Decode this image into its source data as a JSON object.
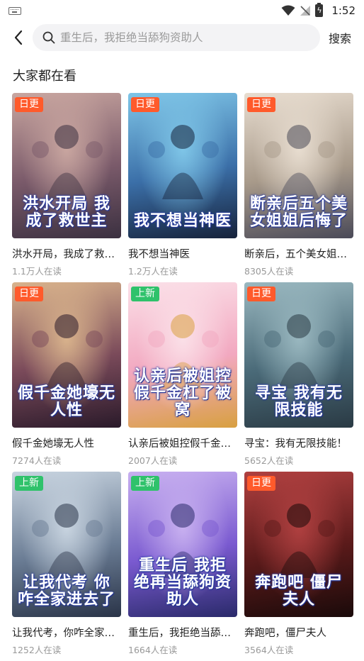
{
  "status_bar": {
    "time": "1:52",
    "icons": [
      "keyboard-icon",
      "wifi-icon",
      "no-signal-icon",
      "battery-charging-icon"
    ]
  },
  "topbar": {
    "back_icon": "chevron-left-icon",
    "search_icon": "search-icon",
    "search_placeholder": "重生后，我拒绝当舔狗资助人",
    "search_button": "搜索"
  },
  "section": {
    "title": "大家都在看"
  },
  "books": [
    {
      "badge": "日更",
      "badge_type": "daily",
      "cover_text": "洪水开局 我成了救世主",
      "title": "洪水开局，我成了救世主",
      "reads": "1.1万人在读",
      "palette": [
        "#c9a6a0",
        "#7a5a6a",
        "#3b3040"
      ]
    },
    {
      "badge": "日更",
      "badge_type": "daily",
      "cover_text": "我不想当神医",
      "title": "我不想当神医",
      "reads": "1.2万人在读",
      "palette": [
        "#7fc6e8",
        "#3b6fa8",
        "#16223a"
      ]
    },
    {
      "badge": "日更",
      "badge_type": "daily",
      "cover_text": "断亲后五个美女姐姐后悔了",
      "title": "断亲后，五个美女姐姐后悔了",
      "reads": "8305人在读",
      "palette": [
        "#e8ddd0",
        "#a89a8a",
        "#4a4a58"
      ]
    },
    {
      "badge": "日更",
      "badge_type": "daily",
      "cover_text": "假千金她壕无人性",
      "title": "假千金她壕无人性",
      "reads": "7274人在读",
      "palette": [
        "#d9b38c",
        "#7a4a5a",
        "#2a1a2a"
      ]
    },
    {
      "badge": "上新",
      "badge_type": "new",
      "cover_text": "认亲后被姐控假千金杠了被窝",
      "title": "认亲后被姐控假千金杠了被窝",
      "reads": "2007人在读",
      "palette": [
        "#fbe0e8",
        "#f2a8c0",
        "#d8a040"
      ]
    },
    {
      "badge": "日更",
      "badge_type": "daily",
      "cover_text": "寻宝 我有无限技能",
      "title": "寻宝：我有无限技能！",
      "reads": "5652人在读",
      "palette": [
        "#9ab8c0",
        "#4a6a78",
        "#2a3a44"
      ]
    },
    {
      "badge": "上新",
      "badge_type": "new",
      "cover_text": "让我代考 你咋全家进去了",
      "title": "让我代考，你咋全家进去了",
      "reads": "1252人在读",
      "palette": [
        "#c8d4e0",
        "#6a7c94",
        "#2a3448"
      ]
    },
    {
      "badge": "上新",
      "badge_type": "new",
      "cover_text": "重生后 我拒绝再当舔狗资助人",
      "title": "重生后，我拒绝当舔狗资助人",
      "reads": "1664人在读",
      "palette": [
        "#c8b0f0",
        "#7a5ad0",
        "#2a2a6a"
      ]
    },
    {
      "badge": "日更",
      "badge_type": "daily",
      "cover_text": "奔跑吧 僵尸夫人",
      "title": "奔跑吧，僵尸夫人",
      "reads": "3564人在读",
      "palette": [
        "#b04040",
        "#5a1a1a",
        "#1a0a0a"
      ]
    }
  ]
}
